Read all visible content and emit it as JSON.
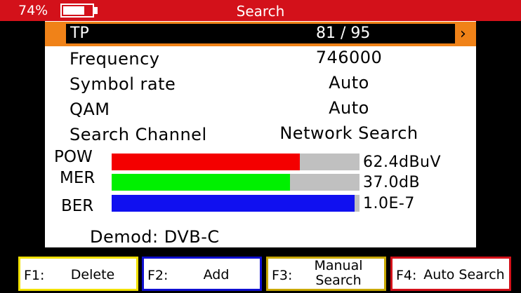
{
  "status": {
    "battery_percent": "74%",
    "battery_level": 0.74,
    "title": "Search"
  },
  "tp": {
    "label": "TP",
    "value": "81 / 95"
  },
  "params": [
    {
      "label": "Frequency",
      "value": "746000"
    },
    {
      "label": "Symbol rate",
      "value": "Auto"
    },
    {
      "label": "QAM",
      "value": "Auto"
    },
    {
      "label": "Search Channel",
      "value": "Network Search"
    }
  ],
  "meters": [
    {
      "label": "POW",
      "value": "62.4dBuV",
      "level": 0.76,
      "color": "#f40000"
    },
    {
      "label": "MER",
      "value": "37.0dB",
      "level": 0.72,
      "color": "#00f000"
    },
    {
      "label": "BER",
      "value": "1.0E-7",
      "level": 0.98,
      "color": "#1010f0"
    }
  ],
  "demod": "Demod: DVB-C",
  "function_keys": [
    {
      "key": "F1:",
      "label": "Delete",
      "color": "#f0e000"
    },
    {
      "key": "F2:",
      "label": "Add",
      "color": "#1010d0"
    },
    {
      "key": "F3:",
      "label": "Manual\nSearch",
      "color": "#c8a800"
    },
    {
      "key": "F4:",
      "label": "Auto Search",
      "color": "#d3111a"
    }
  ]
}
